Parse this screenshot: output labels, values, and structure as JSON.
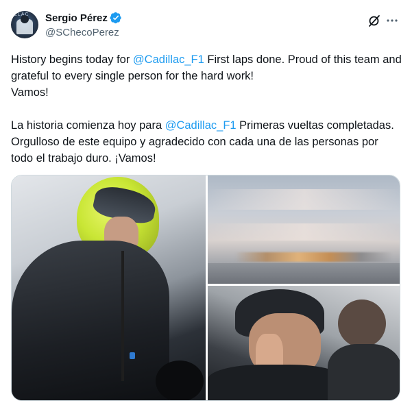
{
  "author": {
    "display_name": "Sergio Pérez",
    "handle": "@SChecoPerez",
    "avatar_text": "ILLAC",
    "verified_color": "#1d9bf0"
  },
  "tweet": {
    "paragraphs": [
      [
        {
          "text": "History begins today for ",
          "type": "text"
        },
        {
          "text": "@Cadillac_F1",
          "type": "mention"
        },
        {
          "text": " First laps done. Proud of this team and grateful to every single person for the hard work!",
          "type": "text"
        }
      ],
      [
        {
          "text": "Vamos!",
          "type": "text"
        }
      ],
      [],
      [
        {
          "text": "La historia comienza hoy para ",
          "type": "text"
        },
        {
          "text": "@Cadillac_F1",
          "type": "mention"
        },
        {
          "text": " Primeras vueltas completadas. Orgulloso de este equipo y agradecido con cada una de las personas por todo el trabajo duro. ¡Vamos!",
          "type": "text"
        }
      ]
    ]
  },
  "media": [
    {
      "name": "driver-in-helmet-photo"
    },
    {
      "name": "blurred-sky-track-photo"
    },
    {
      "name": "driver-with-earpiece-photo"
    }
  ],
  "icons": {
    "grok": "grok-icon",
    "more": "more-options-icon",
    "verified": "verified-badge-icon"
  },
  "colors": {
    "accent": "#1d9bf0",
    "secondary_text": "#536471",
    "primary_text": "#0f1419",
    "border": "#cfd9de",
    "helmet": "#c9e635"
  }
}
